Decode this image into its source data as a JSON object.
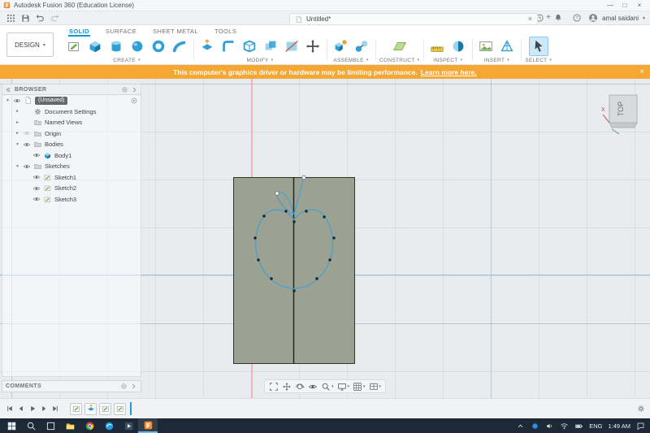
{
  "titlebar": {
    "title": "Autodesk Fusion 360 (Education License)",
    "minimize": "—",
    "maximize": "□",
    "close": "×"
  },
  "qat": {
    "left_icons": [
      "apps-grid",
      "save",
      "undo",
      "redo"
    ],
    "tab_label": "Untitled*",
    "tab_close": "×",
    "new_tab": "+",
    "right_icons": [
      "job-status",
      "notifications",
      "help"
    ],
    "user_name": "amal saidani",
    "user_caret": "▾"
  },
  "ribbon": {
    "design_label": "DESIGN",
    "tabs": [
      {
        "label": "SOLID",
        "active": true
      },
      {
        "label": "SURFACE",
        "active": false
      },
      {
        "label": "SHEET METAL",
        "active": false
      },
      {
        "label": "TOOLS",
        "active": false
      }
    ],
    "groups": [
      {
        "label": "CREATE",
        "icons": [
          "create-sketch",
          "box",
          "cylinder",
          "sphere",
          "torus",
          "pipe"
        ]
      },
      {
        "label": "MODIFY",
        "icons": [
          "press-pull",
          "fillet",
          "shell",
          "combine",
          "split-body",
          "move-copy"
        ]
      },
      {
        "label": "ASSEMBLE",
        "icons": [
          "new-component",
          "joint"
        ]
      },
      {
        "label": "CONSTRUCT",
        "icons": [
          "construction-plane"
        ]
      },
      {
        "label": "INSPECT",
        "icons": [
          "measure",
          "section-analysis"
        ]
      },
      {
        "label": "INSERT",
        "icons": [
          "insert-decal",
          "insert-mesh"
        ]
      },
      {
        "label": "SELECT",
        "icons": [
          "select"
        ],
        "highlight": true
      }
    ]
  },
  "banner": {
    "message": "This computer's graphics driver or hardware may be limiting performance.",
    "link_text": "Learn more here.",
    "close": "×"
  },
  "browser": {
    "title": "BROWSER",
    "items": [
      {
        "label": "(Unsaved)",
        "depth": 0,
        "icon": "document",
        "expander": "open",
        "eye": true,
        "selected": true,
        "radio": true
      },
      {
        "label": "Document Settings",
        "depth": 1,
        "icon": "gear",
        "expander": "closed",
        "eye": false
      },
      {
        "label": "Named Views",
        "depth": 1,
        "icon": "folder",
        "expander": "closed",
        "eye": false
      },
      {
        "label": "Origin",
        "depth": 1,
        "icon": "folder",
        "expander": "closed",
        "eye": "dim"
      },
      {
        "label": "Bodies",
        "depth": 1,
        "icon": "folder",
        "expander": "open",
        "eye": true
      },
      {
        "label": "Body1",
        "depth": 2,
        "icon": "cube",
        "expander": "none",
        "eye": true
      },
      {
        "label": "Sketches",
        "depth": 1,
        "icon": "folder",
        "expander": "open",
        "eye": true
      },
      {
        "label": "Sketch1",
        "depth": 2,
        "icon": "sketch",
        "expander": "none",
        "eye": true
      },
      {
        "label": "Sketch2",
        "depth": 2,
        "icon": "sketch",
        "expander": "none",
        "eye": true
      },
      {
        "label": "Sketch3",
        "depth": 2,
        "icon": "sketch",
        "expander": "none",
        "eye": true
      }
    ]
  },
  "viewcube": {
    "face_label": "TOP",
    "axis_x": "X"
  },
  "navbar": {
    "icons": [
      "fit-view",
      "pan",
      "orbit",
      "look-at",
      "zoom",
      "display-settings",
      "grid-settings",
      "viewports"
    ]
  },
  "comments": {
    "title": "COMMENTS"
  },
  "timeline": {
    "controls": [
      "skip-to-start",
      "step-back",
      "play",
      "step-forward",
      "skip-to-end"
    ],
    "items": [
      "sketch",
      "extrude",
      "sketch",
      "sketch"
    ]
  },
  "taskbar": {
    "apps": [
      "start",
      "search",
      "task-view",
      "file-explorer",
      "chrome",
      "app-blue",
      "app-media",
      "fusion-360"
    ],
    "active_app": "fusion-360",
    "tray_icons": [
      "chevron-up",
      "tray-circle",
      "volume",
      "network",
      "battery"
    ],
    "language": "ENG",
    "clock": "1:49 AM"
  },
  "colors": {
    "accent_blue": "#0a96d4",
    "banner_orange": "#f5a733",
    "body_face": "#9ca292",
    "sketch_blue": "#4e9fcc",
    "taskbar_dark": "#1d2936"
  }
}
